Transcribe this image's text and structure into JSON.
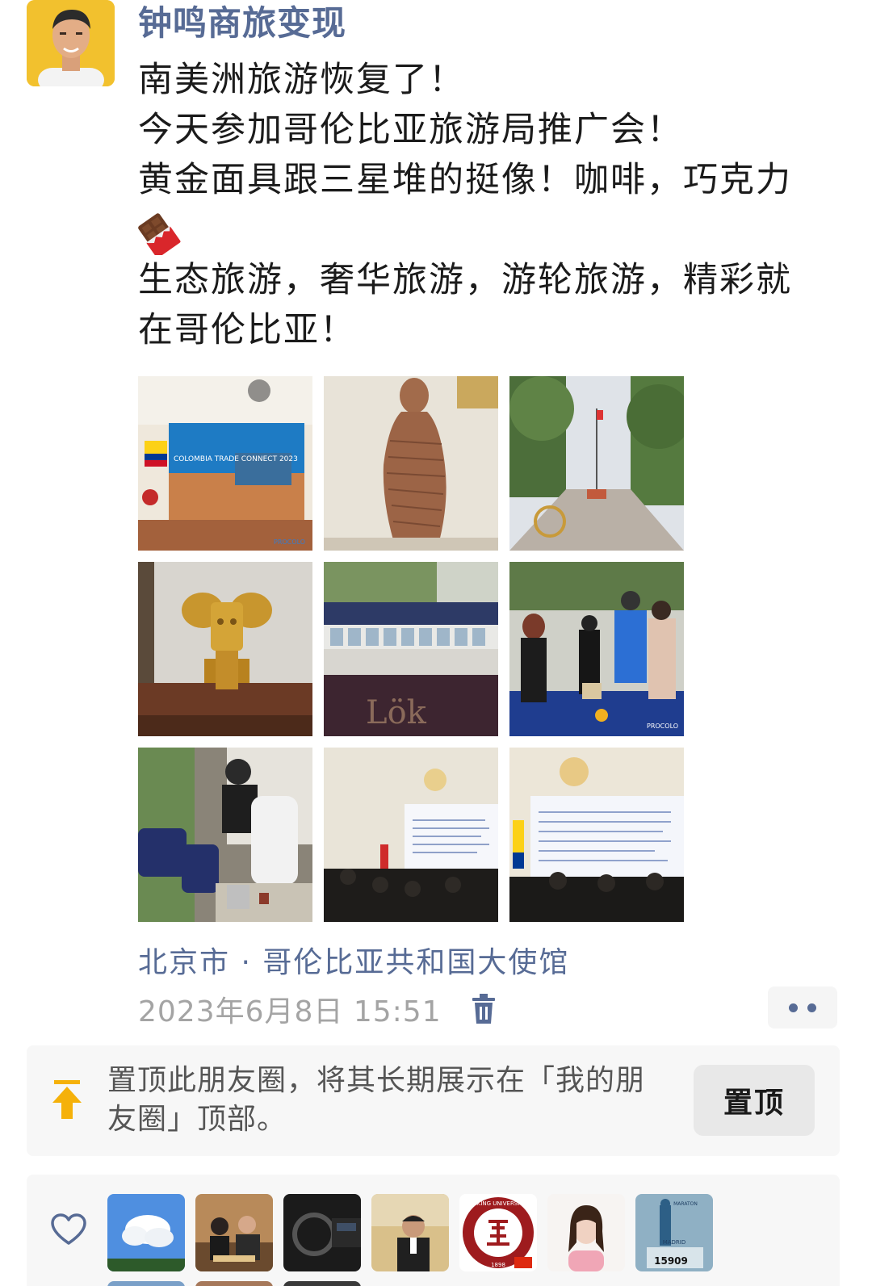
{
  "author": {
    "name": "钟鸣商旅变现"
  },
  "post": {
    "lines": [
      "南美洲旅游恢复了！",
      "今天参加哥伦比亚旅游局推广会！",
      "黄金面具跟三星堆的挺像！咖啡，巧克力",
      "生态旅游，奢华旅游，游轮旅游，精彩就",
      "在哥伦比亚！"
    ],
    "emoji_icon": "chocolate-bar-icon"
  },
  "photos": [
    {
      "name": "photo-event-banner",
      "caption_text": "COLOMBIA TRADE CONNECT 2023",
      "logo_text": "PROCOLO"
    },
    {
      "name": "photo-statue"
    },
    {
      "name": "photo-embassy-garden"
    },
    {
      "name": "photo-gold-mask"
    },
    {
      "name": "photo-coffee-table",
      "brand_text": "Lök"
    },
    {
      "name": "photo-registration",
      "logo_text": "PROCOLO"
    },
    {
      "name": "photo-barista"
    },
    {
      "name": "photo-presentation-1"
    },
    {
      "name": "photo-presentation-2"
    }
  ],
  "location": "北京市 · 哥伦比亚共和国大使馆",
  "timestamp": "2023年6月8日 15:51",
  "icons": {
    "delete": "trash-icon",
    "more": "more-dots-icon",
    "pin": "pin-to-top-icon",
    "like": "heart-icon"
  },
  "pin": {
    "description": "置顶此朋友圈，将其长期展示在「我的朋友圈」顶部。",
    "button_label": "置顶"
  },
  "likes": {
    "avatars": [
      {
        "name": "liker-clouds"
      },
      {
        "name": "liker-couple"
      },
      {
        "name": "liker-car"
      },
      {
        "name": "liker-man"
      },
      {
        "name": "liker-peking-university",
        "text": "PEKING UNIVERSITY",
        "year": "1898"
      },
      {
        "name": "liker-woman"
      },
      {
        "name": "liker-marathon",
        "text": "MARATON",
        "bib": "15909",
        "city": "MADRID"
      }
    ]
  },
  "colors": {
    "link": "#576b95",
    "muted": "#a4a4a4",
    "card": "#f7f7f7"
  }
}
